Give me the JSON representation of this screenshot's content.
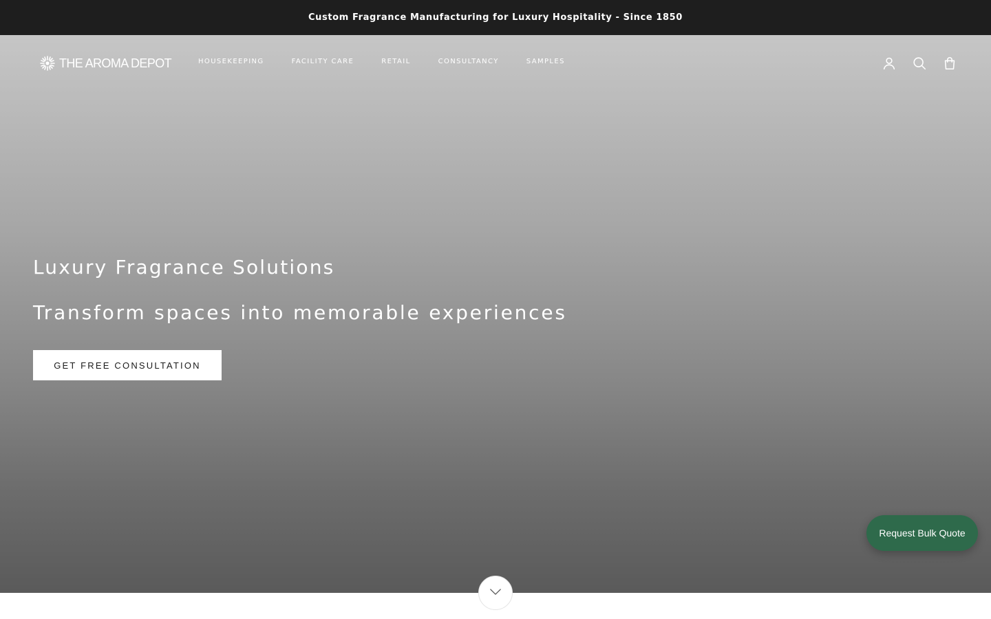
{
  "announcement": {
    "text": "Custom Fragrance Manufacturing for Luxury Hospitality - Since 1850"
  },
  "header": {
    "logo_text": "THE AROMA DEPOT",
    "logo_icon": "starburst-logo-icon",
    "nav": [
      {
        "label": "HOUSEKEEPING"
      },
      {
        "label": "FACILITY CARE"
      },
      {
        "label": "RETAIL"
      },
      {
        "label": "CONSULTANCY"
      },
      {
        "label": "SAMPLES"
      }
    ],
    "icons": [
      "account-icon",
      "search-icon",
      "cart-icon"
    ]
  },
  "hero": {
    "title": "Luxury Fragrance Solutions",
    "subtitle": "Transform spaces into memorable experiences",
    "cta_label": "GET FREE CONSULTATION"
  },
  "floating": {
    "quote_label": "Request Bulk Quote",
    "scroll_icon": "chevron-down-icon"
  },
  "colors": {
    "announcement_bg": "#1e1e1e",
    "quote_button_bg": "#2e6a4b",
    "cta_bg": "#ffffff"
  }
}
